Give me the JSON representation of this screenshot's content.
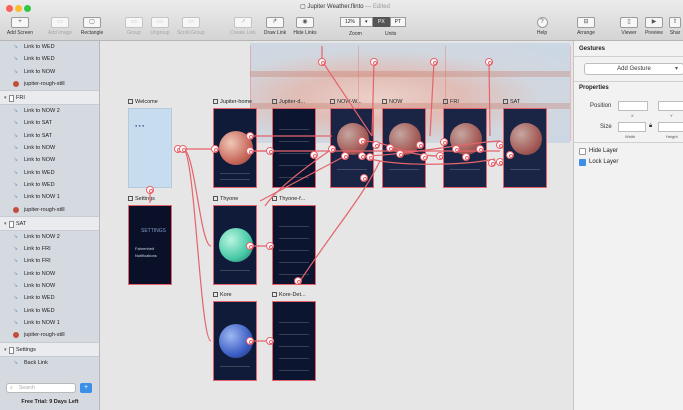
{
  "window": {
    "title": "Jupiter Weather.flinto",
    "status": "— Edited"
  },
  "toolbar": {
    "add_screen": "Add Screen",
    "add_image": "Add Image",
    "rectangle": "Rectangle",
    "group": "Group",
    "ungroup": "Ungroup",
    "scroll_group": "Scroll Group",
    "create_link": "Create Link",
    "draw_link": "Draw Link",
    "hide_links": "Hide Links",
    "zoom_value": "12%",
    "zoom_label": "Zoom",
    "units_px": "PX",
    "units_pt": "PT",
    "units_label": "Units",
    "help": "Help",
    "arrange": "Arrange",
    "viewer": "Viewer",
    "preview": "Preview",
    "share": "Shar"
  },
  "sidebar": {
    "top_items": [
      {
        "label": "Link to WED",
        "kind": "link"
      },
      {
        "label": "Link to WED",
        "kind": "link"
      },
      {
        "label": "Link to NOW",
        "kind": "link"
      },
      {
        "label": "jupiter-rough-still",
        "kind": "image"
      }
    ],
    "groups": [
      {
        "name": "FRI",
        "items": [
          {
            "label": "Link to NOW 2",
            "kind": "link"
          },
          {
            "label": "Link to SAT",
            "kind": "link"
          },
          {
            "label": "Link to SAT",
            "kind": "link"
          },
          {
            "label": "Link to NOW",
            "kind": "link"
          },
          {
            "label": "Link to NOW",
            "kind": "link"
          },
          {
            "label": "Link to WED",
            "kind": "link"
          },
          {
            "label": "Link to WED",
            "kind": "link"
          },
          {
            "label": "Link to NOW 1",
            "kind": "link"
          },
          {
            "label": "jupiter-rough-still",
            "kind": "image"
          }
        ]
      },
      {
        "name": "SAT",
        "items": [
          {
            "label": "Link to NOW 2",
            "kind": "link"
          },
          {
            "label": "Link to FRI",
            "kind": "link"
          },
          {
            "label": "Link to FRI",
            "kind": "link"
          },
          {
            "label": "Link to NOW",
            "kind": "link"
          },
          {
            "label": "Link to NOW",
            "kind": "link"
          },
          {
            "label": "Link to WED",
            "kind": "link"
          },
          {
            "label": "Link to WED",
            "kind": "link"
          },
          {
            "label": "Link to NOW 1",
            "kind": "link"
          },
          {
            "label": "jupiter-rough-still",
            "kind": "image"
          }
        ]
      },
      {
        "name": "Settings",
        "items": [
          {
            "label": "Back Link",
            "kind": "link"
          }
        ]
      }
    ],
    "search_placeholder": "Search",
    "trial": "Free Trial: 9 Days Left"
  },
  "canvas": {
    "screens": {
      "welcome": "Welcome",
      "jupiter_home": "Jupiter-home",
      "jupiter_d": "Jupiter-d...",
      "nowv": "NOW-W...",
      "now": "NOW",
      "fri": "FRI",
      "sat": "SAT",
      "settings": "Settings",
      "thyone": "Thyone",
      "thyone_f": "Thyone-f...",
      "kore": "Kore",
      "kore_det": "Kore-Det..."
    },
    "settings_text": "SETTINGS",
    "settings_opt1": "Fahrenheit",
    "settings_opt2": "Notifications"
  },
  "inspector": {
    "gestures_head": "Gestures",
    "add_gesture": "Add Gesture",
    "properties_head": "Properties",
    "position_label": "Position",
    "x_label": "X",
    "y_label": "Y",
    "size_label": "Size",
    "width_label": "Width",
    "height_label": "Height",
    "hide_layer": "Hide Layer",
    "lock_layer": "Lock Layer"
  },
  "colors": {
    "link": "#e5636a",
    "accent": "#3b8fe6",
    "screen_bg": "#0f1b38"
  }
}
